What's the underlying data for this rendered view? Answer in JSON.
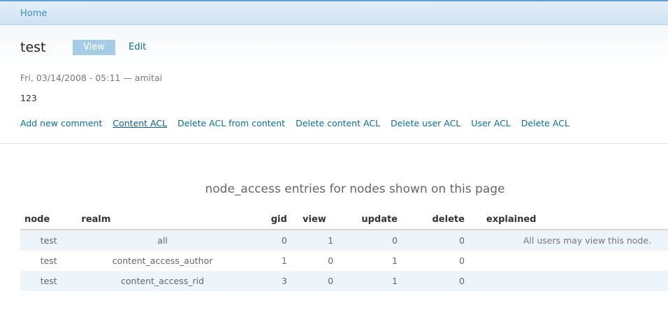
{
  "breadcrumb": {
    "home": "Home"
  },
  "node": {
    "title": "test",
    "tabs": [
      {
        "label": "View",
        "active": true
      },
      {
        "label": "Edit",
        "active": false
      }
    ],
    "submitted": "Fri, 03/14/2008 - 05:11 — amitai",
    "body": "123"
  },
  "links": [
    "Add new comment",
    "Content ACL",
    "Delete ACL from content",
    "Delete content ACL",
    "Delete user ACL",
    "User ACL",
    "Delete ACL"
  ],
  "table": {
    "caption": "node_access entries for nodes shown on this page",
    "headers": [
      "node",
      "realm",
      "gid",
      "view",
      "update",
      "delete",
      "explained"
    ],
    "rows": [
      [
        "test",
        "all",
        "0",
        "1",
        "0",
        "0",
        "All users may view this node."
      ],
      [
        "test",
        "content_access_author",
        "1",
        "0",
        "1",
        "0",
        ""
      ],
      [
        "test",
        "content_access_rid",
        "3",
        "0",
        "1",
        "0",
        ""
      ]
    ]
  },
  "colors": {
    "link": "#0a6e9c",
    "tab_active_bg": "#a7cde6",
    "row_odd_bg": "#edf4fa",
    "header_bar": "#cfe3f2"
  }
}
